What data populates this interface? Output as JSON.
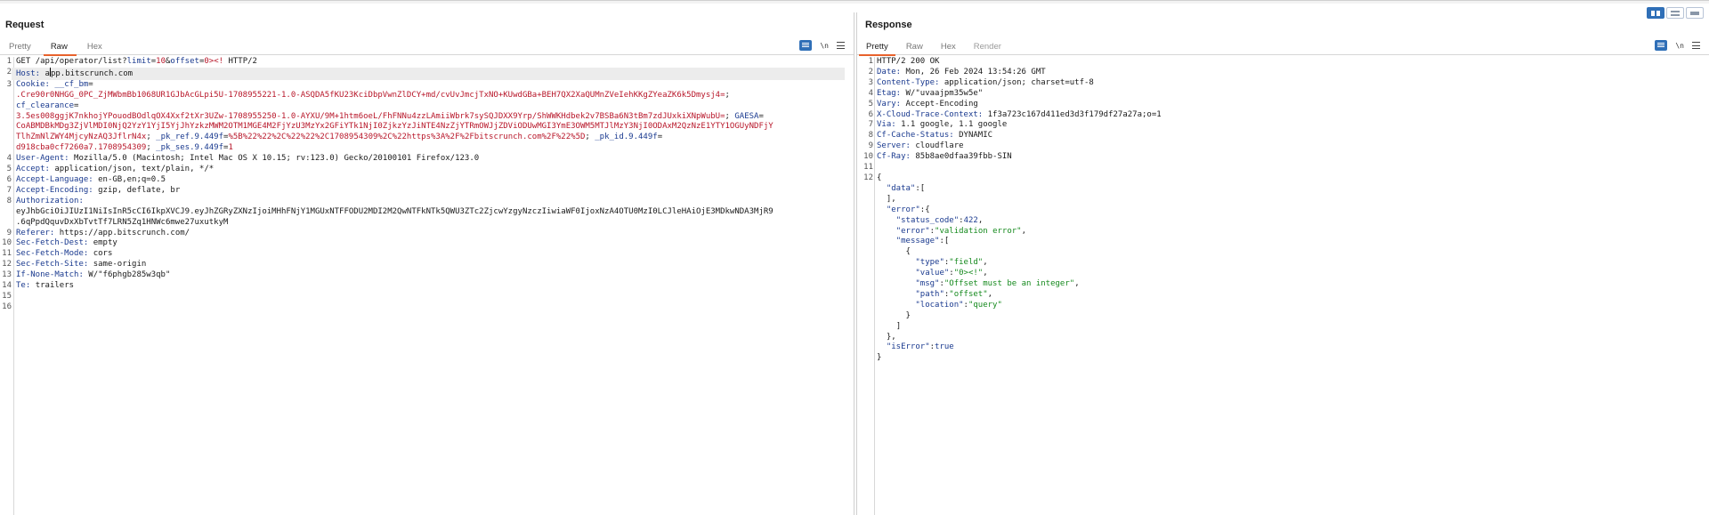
{
  "request": {
    "title": "Request",
    "tabs": [
      {
        "label": "Pretty"
      },
      {
        "label": "Raw"
      },
      {
        "label": "Hex"
      }
    ],
    "tools": {
      "newline_label": "\\n"
    },
    "line_numbers": [
      "1",
      "2",
      "3",
      "",
      "",
      "",
      "",
      "",
      "",
      "",
      "4",
      "5",
      "6",
      "7",
      "8",
      "",
      "",
      "9",
      "10",
      "11",
      "12",
      "13",
      "14",
      "15",
      "16"
    ],
    "method": "GET ",
    "path_a": "/api/operator/list?",
    "param_limit_k": "limit",
    "param_eq1": "=",
    "param_limit_v": "10",
    "param_amp": "&",
    "param_offset_k": "offset",
    "param_eq2": "=",
    "param_offset_v": "0><!",
    "protocol": " HTTP/2",
    "host_k": "Host: ",
    "host_v1": "a",
    "host_v2": "pp.bitscrunch.com",
    "cookie_k": "Cookie: ",
    "cookie_l1_k": "__cf_bm",
    "cookie_l1_eq": "=",
    "cookie_l2_v": ".Cre90r0NHGG_0PC_ZjMWbmBb1068UR1GJbAcGLpi5U-1708955221-1.0-ASQDA5fKU23KciDbpVwnZlDCY+md/cvUvJmcjTxNO+KUwdGBa+BEH7QX2XaQUMnZVeIehKKgZYeaZK6k5Dmysj4=",
    "cookie_l2_sep": ";",
    "cookie_l3_k": "cf_clearance",
    "cookie_l3_eq": "=",
    "cookie_l4_v": "3.5es008ggjK7nkhojYPouodBOdlqOX4Xxf2tXr3UZw-1708955250-1.0-AYXU/9M+1htm6oeL/FhFNNu4zzLAmiiWbrk7sySQJDXX9Yrp/ShWWKHdbek2v7BSBa6N3tBm7zdJUxkiXNpWubU=",
    "cookie_l4_sep": "; ",
    "cookie_l4_k": "GAESA",
    "cookie_l4_eq": "=",
    "cookie_l5_v": "CoABMDBkMDg3ZjVlMDI0NjQ2YzY1YjI5YjJhYzkzMWM2OTM1MGE4M2FjYzU3MzYx2GFiYTk1NjI0ZjkzYzJiNTE4NzZjYTRmOWJjZDViODUwMGI3YmE3OWM5MTJlMzY3NjI0ODAxM2QzNzE1YTY1OGUyNDFjY",
    "cookie_l6_v": "TlhZmNlZWY4MjcyNzAQ3JflrN4x",
    "cookie_l6_sep": "; ",
    "cookie_l6_k1": "_pk_ref.9.449f",
    "cookie_l6_eq1": "=",
    "cookie_l6_v1": "%5B%22%22%2C%22%22%2C1708954309%2C%22https%3A%2F%2Fbitscrunch.com%2F%22%5D",
    "cookie_l6_sep2": "; ",
    "cookie_l6_k2": "_pk_id.9.449f",
    "cookie_l6_eq2": "=",
    "cookie_l7_v": "d918cba0cf7260a7.1708954309",
    "cookie_l7_sep": "; ",
    "cookie_l7_k": "_pk_ses.9.449f",
    "cookie_l7_eq": "=",
    "cookie_l7_v2": "1",
    "ua_k": "User-Agent: ",
    "ua_v": "Mozilla/5.0 (Macintosh; Intel Mac OS X 10.15; rv:123.0) Gecko/20100101 Firefox/123.0",
    "accept_k": "Accept: ",
    "accept_v": "application/json, text/plain, */*",
    "lang_k": "Accept-Language: ",
    "lang_v": "en-GB,en;q=0.5",
    "enc_k": "Accept-Encoding: ",
    "enc_v": "gzip, deflate, br",
    "auth_k": "Authorization: ",
    "auth_l1": "eyJhbGciOiJIUzI1NiIsInR5cCI6IkpXVCJ9.eyJhZGRyZXNzIjoiMHhFNjY1MGUxNTFFODU2MDI2M2QwNTFkNTk5QWU3ZTc2ZjcwYzgyNzczIiwiaWF0IjoxNzA4OTU0MzI0LCJleHAiOjE3MDkwNDA3MjR9",
    "auth_l2": ".6qPpdQquvDxXbTvtTf7LRN5Zq1HNWc6mwe27uxutkyM",
    "ref_k": "Referer: ",
    "ref_v": "https://app.bitscrunch.com/",
    "sfd_k": "Sec-Fetch-Dest: ",
    "sfd_v": "empty",
    "sfm_k": "Sec-Fetch-Mode: ",
    "sfm_v": "cors",
    "sfs_k": "Sec-Fetch-Site: ",
    "sfs_v": "same-origin",
    "inm_k": "If-None-Match: ",
    "inm_v": "W/\"f6phgb285w3qb\"",
    "te_k": "Te: ",
    "te_v": "trailers"
  },
  "response": {
    "title": "Response",
    "tabs": [
      {
        "label": "Pretty"
      },
      {
        "label": "Raw"
      },
      {
        "label": "Hex"
      },
      {
        "label": "Render"
      }
    ],
    "tools": {
      "newline_label": "\\n"
    },
    "line_numbers": [
      "1",
      "2",
      "3",
      "4",
      "5",
      "6",
      "7",
      "8",
      "9",
      "10",
      "11",
      "12",
      "",
      "",
      "",
      "",
      "",
      "",
      "",
      "",
      "",
      "",
      "",
      "",
      "",
      "",
      "",
      "",
      ""
    ],
    "status_line": "HTTP/2 200 OK",
    "headers": [
      {
        "k": "Date: ",
        "v": "Mon, 26 Feb 2024 13:54:26 GMT"
      },
      {
        "k": "Content-Type: ",
        "v": "application/json; charset=utf-8"
      },
      {
        "k": "Etag: ",
        "v": "W/\"uvaajpm35w5e\""
      },
      {
        "k": "Vary: ",
        "v": "Accept-Encoding"
      },
      {
        "k": "X-Cloud-Trace-Context: ",
        "v": "1f3a723c167d411ed3d3f179df27a27a;o=1"
      },
      {
        "k": "Via: ",
        "v": "1.1 google, 1.1 google"
      },
      {
        "k": "Cf-Cache-Status: ",
        "v": "DYNAMIC"
      },
      {
        "k": "Server: ",
        "v": "cloudflare"
      },
      {
        "k": "Cf-Ray: ",
        "v": "85b8ae0dfaa39fbb-SIN"
      }
    ],
    "json": {
      "open": "{",
      "data_key": "\"data\"",
      "data_open": ":[",
      "data_close": "],",
      "error_key": "\"error\"",
      "error_open": ":{",
      "status_code_key": "\"status_code\"",
      "status_code_val": "422",
      "error_msg_key": "\"error\"",
      "error_msg_val": "\"validation error\"",
      "message_key": "\"message\"",
      "message_open": ":[",
      "obj_open": "{",
      "type_key": "\"type\"",
      "type_val": "\"field\"",
      "value_key": "\"value\"",
      "value_val": "\"0><!\"",
      "msg_key": "\"msg\"",
      "msg_val": "\"Offset must be an integer\"",
      "path_key": "\"path\"",
      "path_val": "\"offset\"",
      "location_key": "\"location\"",
      "location_val": "\"query\"",
      "obj_close": "}",
      "message_close": "]",
      "error_close": "},",
      "iserror_key": "\"isError\"",
      "iserror_val": "true",
      "close": "}"
    }
  }
}
